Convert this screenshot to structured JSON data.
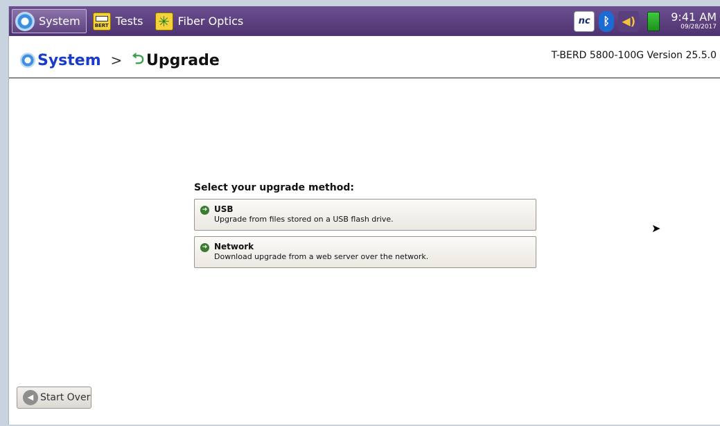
{
  "taskbar": {
    "tabs": [
      {
        "label": "System",
        "icon": "gear-icon"
      },
      {
        "label": "Tests",
        "icon": "bert-icon",
        "icon_text": "BERT"
      },
      {
        "label": "Fiber Optics",
        "icon": "fiber-icon"
      }
    ],
    "tray": {
      "nc_label": "nc",
      "time": "9:41 AM",
      "date": "09/28/2017"
    }
  },
  "header": {
    "crumb_root": "System",
    "separator": ">",
    "crumb_page": "Upgrade",
    "version": "T-BERD 5800-100G Version 25.5.0"
  },
  "main": {
    "prompt": "Select your upgrade method:",
    "methods": [
      {
        "title": "USB",
        "desc": "Upgrade from files stored on a USB flash drive."
      },
      {
        "title": "Network",
        "desc": "Download upgrade from a web server over the network."
      }
    ]
  },
  "footer": {
    "start_over": "Start Over"
  },
  "colors": {
    "taskbar": "#5c4080",
    "crumb_root": "#1a3bc8",
    "go_icon": "#3a7c2e"
  }
}
